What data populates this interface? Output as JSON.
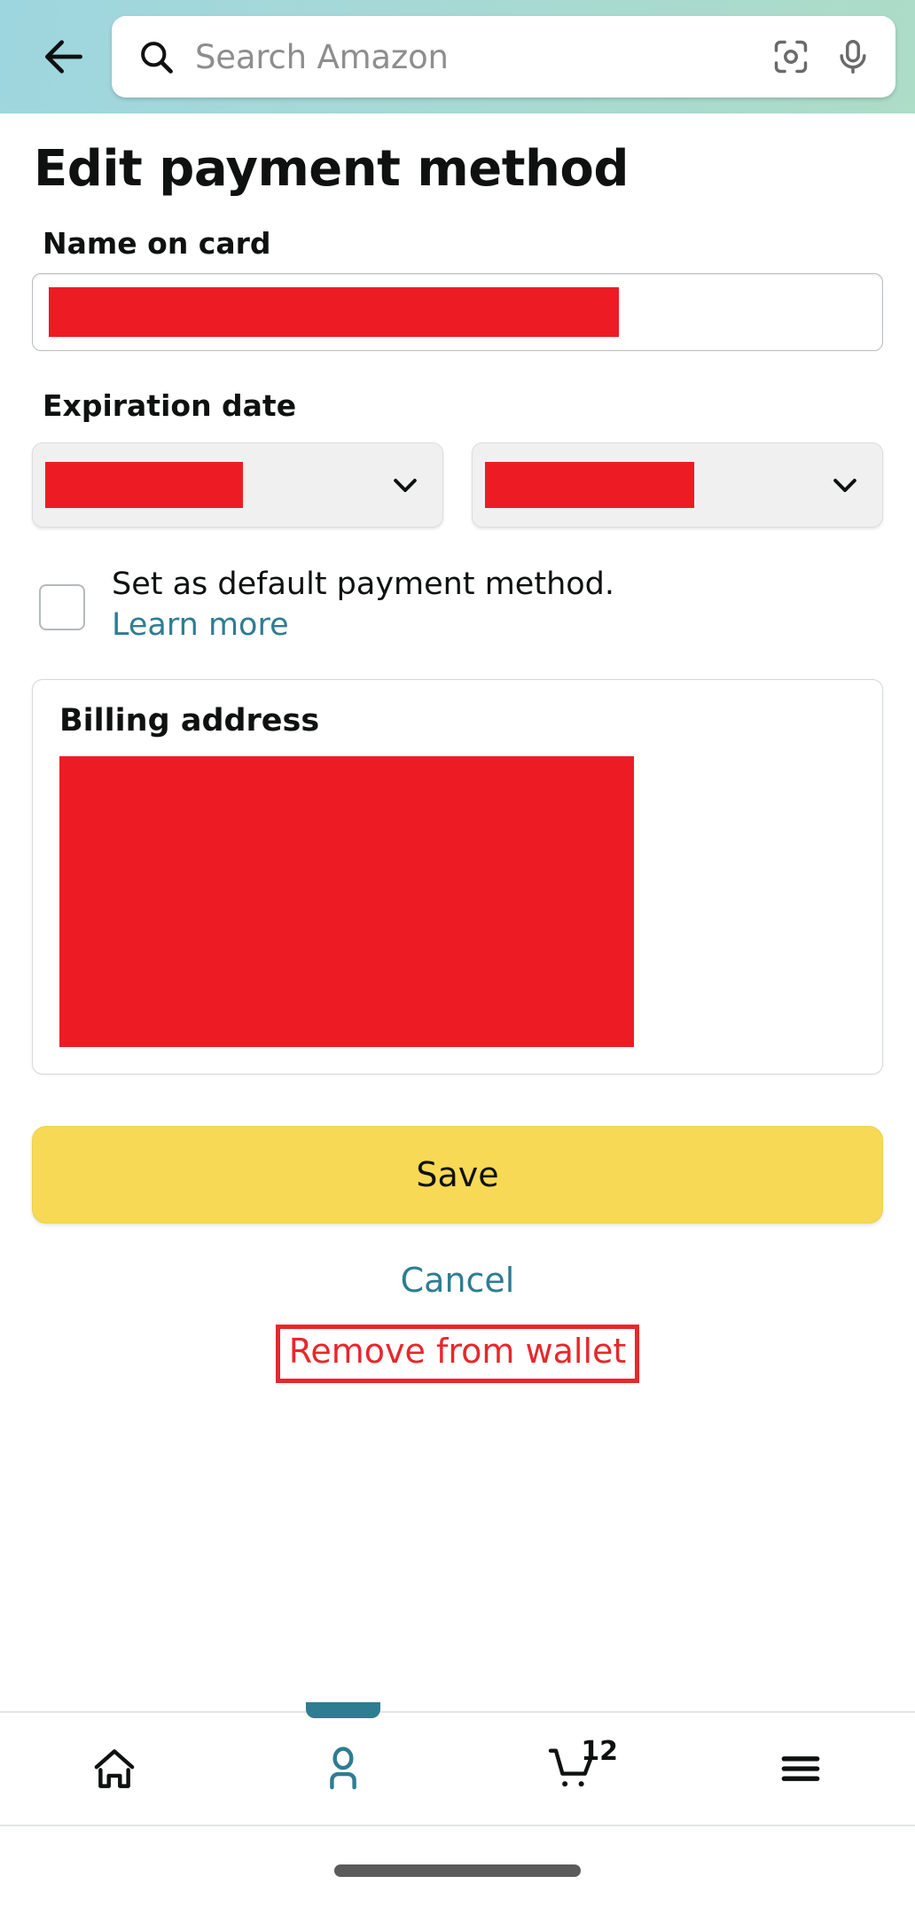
{
  "header": {
    "back_icon": "arrow-left-icon",
    "search": {
      "placeholder": "Search Amazon",
      "value": "",
      "search_icon": "search-icon",
      "camera_icon": "camera-scan-icon",
      "mic_icon": "microphone-icon"
    },
    "gradient_from": "#9ED6DF",
    "gradient_to": "#ADDCC7"
  },
  "main": {
    "title": "Edit payment method",
    "name_on_card": {
      "label": "Name on card",
      "value": "",
      "redacted": true
    },
    "expiration": {
      "label": "Expiration date",
      "month": {
        "value": "",
        "redacted": true,
        "chevron_icon": "chevron-down-icon"
      },
      "year": {
        "value": "",
        "redacted": true,
        "chevron_icon": "chevron-down-icon"
      }
    },
    "default_checkbox": {
      "checked": false,
      "text": "Set as default payment method. ",
      "link_text": "Learn more"
    },
    "billing_address": {
      "title": "Billing address",
      "value": "",
      "redacted": true
    },
    "save_label": "Save",
    "cancel_label": "Cancel",
    "remove_label": "Remove from wallet"
  },
  "colors": {
    "redaction": "#ED1C24",
    "save_yellow": "#F7D955",
    "link_teal": "#2E7D92",
    "remove_red": "#E8272C"
  },
  "bottom_nav": {
    "items": [
      {
        "name": "home",
        "icon": "home-icon",
        "active": false
      },
      {
        "name": "account",
        "icon": "person-icon",
        "active": true
      },
      {
        "name": "cart",
        "icon": "cart-icon",
        "active": false,
        "badge": "12"
      },
      {
        "name": "menu",
        "icon": "hamburger-menu-icon",
        "active": false
      }
    ]
  }
}
